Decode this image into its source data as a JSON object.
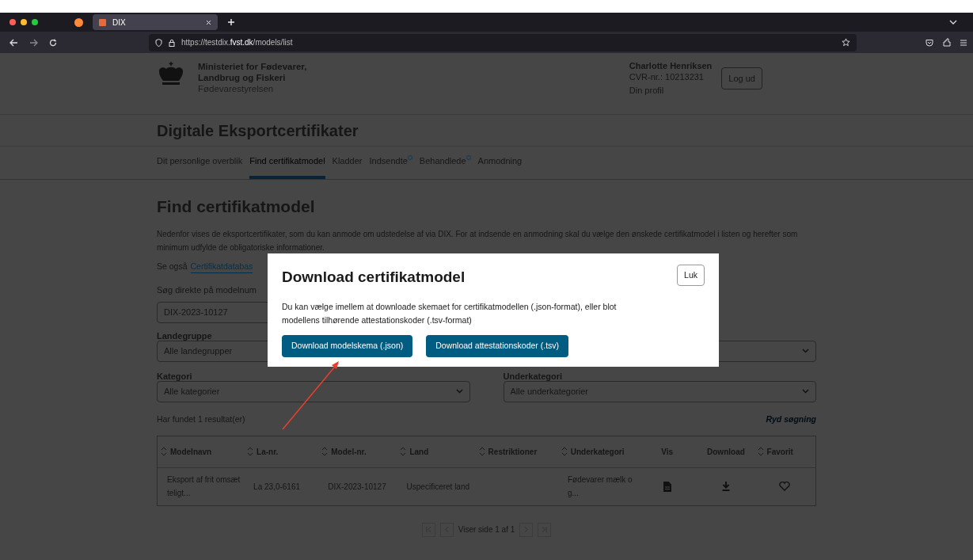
{
  "browser": {
    "tab_title": "DIX",
    "url_prefix": "https://testdix.",
    "url_host": "fvst.dk",
    "url_path": "/models/list"
  },
  "header": {
    "org_line1": "Ministeriet for Fødevarer,",
    "org_line2": "Landbrug og Fiskeri",
    "org_sub": "Fødevarestyrelsen",
    "user_name": "Charlotte Henriksen",
    "cvr": "CVR-nr.: 10213231",
    "profile_link": "Din profil",
    "logout": "Log ud"
  },
  "site_title": "Digitale Eksportcertifikater",
  "nav": [
    {
      "label": "Dit personlige overblik",
      "selected": false,
      "dot": false
    },
    {
      "label": "Find certifikatmodel",
      "selected": true,
      "dot": false
    },
    {
      "label": "Kladder",
      "selected": false,
      "dot": false
    },
    {
      "label": "Indsendte",
      "selected": false,
      "dot": true
    },
    {
      "label": "Behandlede",
      "selected": false,
      "dot": true
    },
    {
      "label": "Anmodning",
      "selected": false,
      "dot": false
    }
  ],
  "page": {
    "heading": "Find certifikatmodel",
    "intro": "Nedenfor vises de eksportcertifikater, som du kan anmode om udstedelse af via DIX. For at indsende en anmodning skal du vælge den ønskede certifikatmodel i listen og herefter som minimum udfylde de obligatoriske informationer.",
    "see_also": "Se også",
    "see_also_link": "Certifikatdatabas",
    "search_label": "Søg direkte på modelnum",
    "search_value": "DIX-2023-10127"
  },
  "filters": [
    {
      "kind": "labeled",
      "label": "Landegruppe",
      "value": "Alle landegrupper"
    },
    {
      "kind": "covered"
    },
    {
      "kind": "labeled",
      "label": "Kategori",
      "value": "Alle kategorier"
    },
    {
      "kind": "labeled",
      "label": "Underkategori",
      "value": "Alle underkategorier"
    }
  ],
  "result_count": "Har fundet 1 resultat(er)",
  "clear_search": "Ryd søgning",
  "table": {
    "columns": [
      {
        "label": "Modelnavn",
        "sortable": true
      },
      {
        "label": "La-nr.",
        "sortable": true
      },
      {
        "label": "Model-nr.",
        "sortable": true
      },
      {
        "label": "Land",
        "sortable": true
      },
      {
        "label": "Restriktioner",
        "sortable": true
      },
      {
        "label": "Underkategori",
        "sortable": true
      },
      {
        "label": "Vis",
        "sortable": false
      },
      {
        "label": "Download",
        "sortable": false
      },
      {
        "label": "Favorit",
        "sortable": true
      }
    ],
    "rows": [
      {
        "cells": [
          "Eksport af frit omsætteligt...",
          "La 23,0-6161",
          "DIX-2023-10127",
          "Uspecificeret land",
          "",
          "Fødevarer mælk og..."
        ],
        "favorite": false
      }
    ]
  },
  "pagination": {
    "label": "Viser side 1 af 1"
  },
  "modal": {
    "title": "Download certifikatmodel",
    "close": "Luk",
    "text": "Du kan vælge imellem at downloade skemaet for certifikatmodellen (.json-format), eller blot modellens tilhørende attestationskoder (.tsv-format)",
    "buttons": [
      "Download modelskema (.json)",
      "Download attestationskoder (.tsv)"
    ]
  }
}
